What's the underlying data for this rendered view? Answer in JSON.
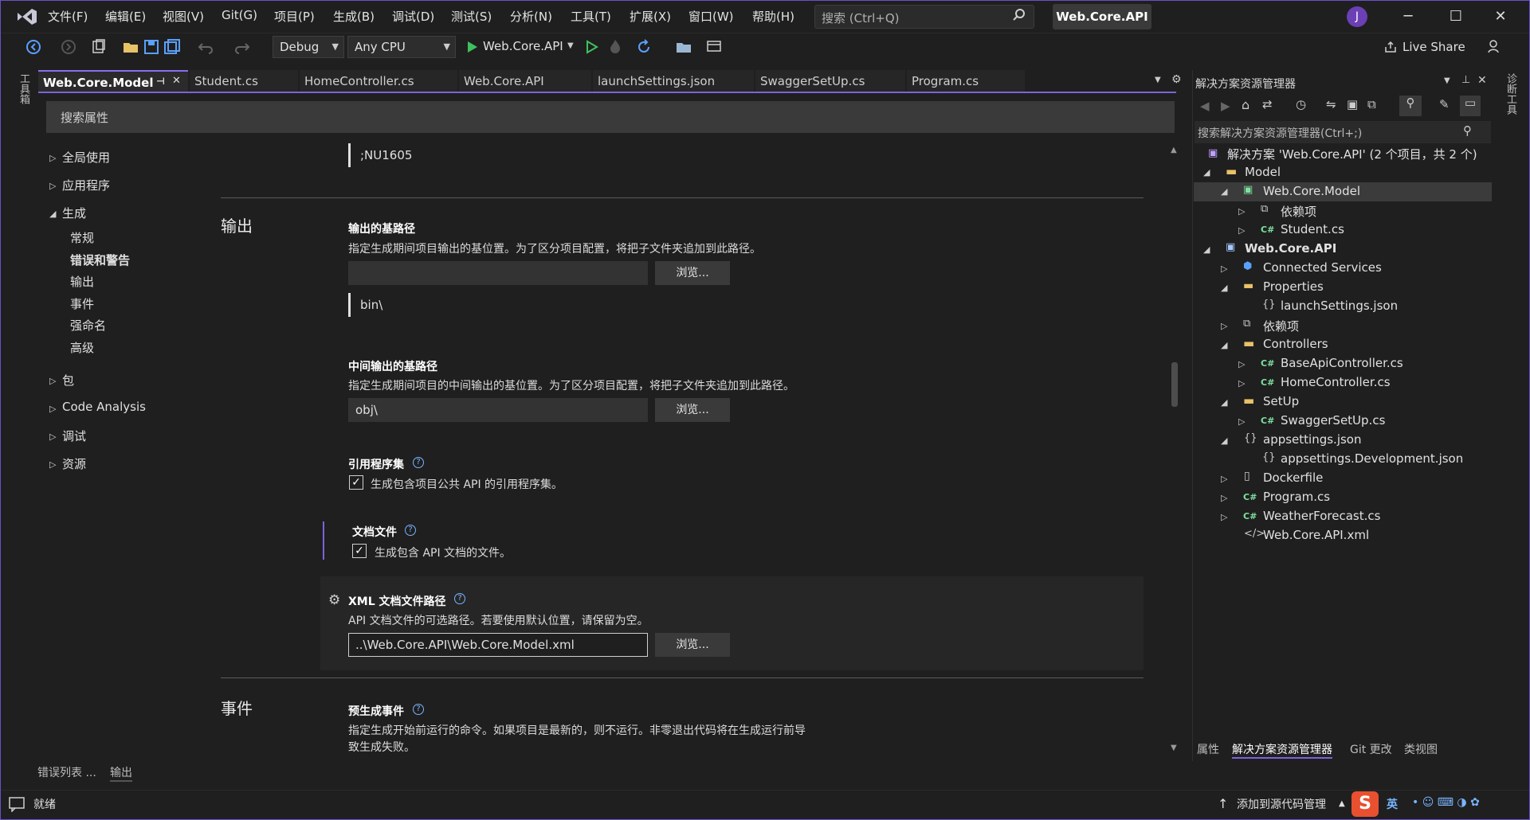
{
  "menu": [
    "文件(F)",
    "编辑(E)",
    "视图(V)",
    "Git(G)",
    "项目(P)",
    "生成(B)",
    "调试(D)",
    "测试(S)",
    "分析(N)",
    "工具(T)",
    "扩展(X)",
    "窗口(W)",
    "帮助(H)"
  ],
  "search": {
    "placeholder": "搜索 (Ctrl+Q)"
  },
  "solution_name": "Web.Core.API",
  "avatar_initial": "J",
  "toolbar": {
    "config": "Debug",
    "platform": "Any CPU",
    "run_target": "Web.Core.API",
    "live_share": "Live Share"
  },
  "rail_label": "工具箱",
  "right_rail_label": "诊断工具",
  "tabs": [
    "Web.Core.Model",
    "Student.cs",
    "HomeController.cs",
    "Web.Core.API",
    "launchSettings.json",
    "SwaggerSetUp.cs",
    "Program.cs"
  ],
  "props": {
    "search_label": "搜索属性",
    "nav": {
      "global": "全局使用",
      "app": "应用程序",
      "build": "生成",
      "build_children": [
        "常规",
        "错误和警告",
        "输出",
        "事件",
        "强命名",
        "高级"
      ],
      "package": "包",
      "code_analysis": "Code Analysis",
      "debug": "调试",
      "resources": "资源"
    },
    "nowarn_value": ";NU1605",
    "output_section": "输出",
    "output_path": {
      "label": "输出的基路径",
      "desc": "指定生成期间项目输出的基位置。为了区分项目配置，将把子文件夹追加到此路径。",
      "value": "",
      "browse": "浏览...",
      "effective": "bin\\"
    },
    "intermediate_path": {
      "label": "中间输出的基路径",
      "desc": "指定生成期间项目的中间输出的基位置。为了区分项目配置，将把子文件夹追加到此路径。",
      "value": "obj\\",
      "browse": "浏览..."
    },
    "ref_assembly": {
      "label": "引用程序集",
      "check": "生成包含项目公共 API 的引用程序集。"
    },
    "doc_file": {
      "label": "文档文件",
      "check": "生成包含 API 文档的文件。"
    },
    "xml_doc_path": {
      "label": "XML 文档文件路径",
      "desc": "API 文档文件的可选路径。若要使用默认位置，请保留为空。",
      "value": "..\\Web.Core.API\\Web.Core.Model.xml",
      "browse": "浏览..."
    },
    "events_section": "事件",
    "prebuild": {
      "label": "预生成事件",
      "desc_line1": "指定生成开始前运行的命令。如果项目是最新的，则不运行。非零退出代码将在生成运行前导",
      "desc_line2": "致生成失败。"
    }
  },
  "solution_explorer": {
    "title": "解决方案资源管理器",
    "search": "搜索解决方案资源管理器(Ctrl+;)",
    "items": [
      {
        "label": "解决方案 'Web.Core.API' (2 个项目，共 2 个)"
      },
      {
        "label": "Model"
      },
      {
        "label": "Web.Core.Model"
      },
      {
        "label": "依赖项"
      },
      {
        "label": "Student.cs"
      },
      {
        "label": "Web.Core.API"
      },
      {
        "label": "Connected Services"
      },
      {
        "label": "Properties"
      },
      {
        "label": "launchSettings.json"
      },
      {
        "label": "依赖项"
      },
      {
        "label": "Controllers"
      },
      {
        "label": "BaseApiController.cs"
      },
      {
        "label": "HomeController.cs"
      },
      {
        "label": "SetUp"
      },
      {
        "label": "SwaggerSetUp.cs"
      },
      {
        "label": "appsettings.json"
      },
      {
        "label": "appsettings.Development.json"
      },
      {
        "label": "Dockerfile"
      },
      {
        "label": "Program.cs"
      },
      {
        "label": "WeatherForecast.cs"
      },
      {
        "label": "Web.Core.API.xml"
      }
    ],
    "bottom_tabs": [
      "属性",
      "解决方案资源管理器",
      "Git 更改",
      "类视图"
    ]
  },
  "bottom_tabs": [
    "错误列表 ...",
    "输出"
  ],
  "status": {
    "ready": "就绪",
    "add_source_control": "添加到源代码管理",
    "ime": "英"
  },
  "colors": {
    "accent": "#7d63d9",
    "background": "#1f1f1f"
  }
}
